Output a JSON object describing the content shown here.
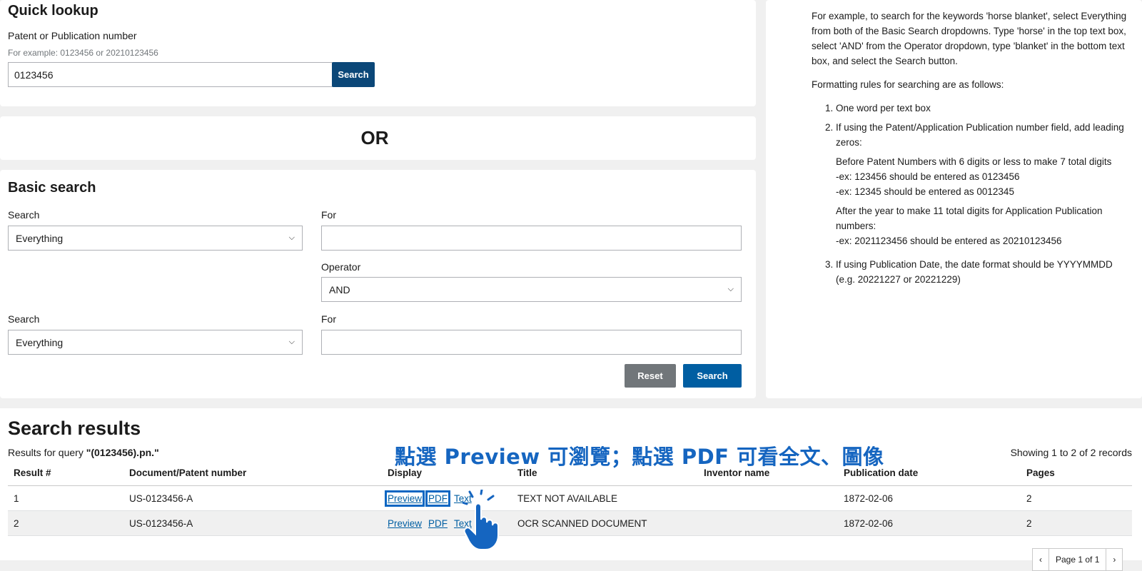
{
  "quick_lookup": {
    "title": "Quick lookup",
    "field_label": "Patent or Publication number",
    "example": "For example: 0123456 or 20210123456",
    "value": "0123456",
    "search_label": "Search"
  },
  "or_label": "OR",
  "basic_search": {
    "title": "Basic search",
    "search_label_1": "Search",
    "select_1": "Everything",
    "for_label_1": "For",
    "for_value_1": "",
    "operator_label": "Operator",
    "operator_value": "AND",
    "search_label_2": "Search",
    "select_2": "Everything",
    "for_label_2": "For",
    "for_value_2": "",
    "reset_label": "Reset",
    "search_label": "Search"
  },
  "help": {
    "intro": "For example, to search for the keywords 'horse blanket', select Everything from both of the Basic Search dropdowns. Type 'horse' in the top text box, select 'AND' from the Operator dropdown, type 'blanket' in the bottom text box, and select the Search button.",
    "rules_intro": "Formatting rules for searching are as follows:",
    "rule1": "One word per text box",
    "rule2": "If using the Patent/Application Publication number field, add leading zeros:",
    "rule2_patent": "Before Patent Numbers with 6 digits or less to make 7 total digits",
    "rule2_ex1": "-ex: 123456 should be entered as 0123456",
    "rule2_ex2": "-ex: 12345 should be entered as 0012345",
    "rule2_app": "After the year to make 11 total digits for Application Publication numbers:",
    "rule2_ex3": "-ex: 2021123456 should be entered as 20210123456",
    "rule3": "If using Publication Date, the date format should be YYYYMMDD (e.g. 20221227 or 20221229)"
  },
  "results": {
    "title": "Search results",
    "query_prefix": "Results for query ",
    "query": "\"(0123456).pn.\"",
    "showing": "Showing 1 to 2 of 2 records",
    "columns": [
      "Result #",
      "Document/Patent number",
      "Display",
      "Title",
      "Inventor name",
      "Publication date",
      "Pages"
    ],
    "rows": [
      {
        "num": "1",
        "doc": "US-0123456-A",
        "preview": "Preview",
        "pdf": "PDF",
        "text": "Text",
        "title": "TEXT NOT AVAILABLE",
        "inventor": "",
        "date": "1872-02-06",
        "pages": "2"
      },
      {
        "num": "2",
        "doc": "US-0123456-A",
        "preview": "Preview",
        "pdf": "PDF",
        "text": "Text",
        "title": "OCR SCANNED DOCUMENT",
        "inventor": "",
        "date": "1872-02-06",
        "pages": "2"
      }
    ],
    "pager": {
      "prev": "‹",
      "label": "Page 1 of 1",
      "next": "›"
    }
  },
  "annotation": "點選 Preview 可瀏覽；點選 PDF 可看全文、圖像",
  "icons": {
    "select_chevron": "chevron-down-icon",
    "tap_hand": "tap-hand-icon"
  },
  "colors": {
    "primary": "#005ea2",
    "dark_button": "#0b4778",
    "reset_button": "#71767a",
    "annotation": "#1565c0"
  }
}
